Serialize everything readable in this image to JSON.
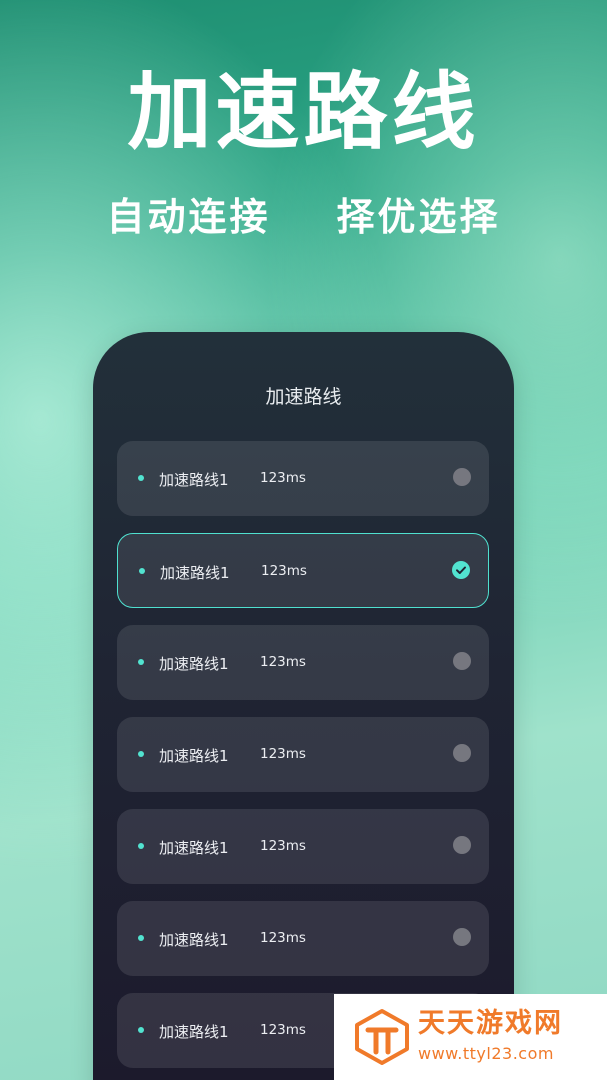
{
  "headline": "加速路线",
  "subline": {
    "left": "自动连接",
    "right": "择优选择"
  },
  "screen": {
    "title": "加速路线",
    "routes": [
      {
        "name": "加速路线1",
        "latency": "123ms",
        "selected": false
      },
      {
        "name": "加速路线1",
        "latency": "123ms",
        "selected": true
      },
      {
        "name": "加速路线1",
        "latency": "123ms",
        "selected": false
      },
      {
        "name": "加速路线1",
        "latency": "123ms",
        "selected": false
      },
      {
        "name": "加速路线1",
        "latency": "123ms",
        "selected": false
      },
      {
        "name": "加速路线1",
        "latency": "123ms",
        "selected": false
      },
      {
        "name": "加速路线1",
        "latency": "123ms",
        "selected": false
      }
    ]
  },
  "watermark": {
    "title": "天天游戏网",
    "url": "www.ttyl23.com",
    "icon": "tt-logo-icon"
  },
  "colors": {
    "accent": "#52e3d0",
    "brand_orange": "#f07a2a"
  }
}
